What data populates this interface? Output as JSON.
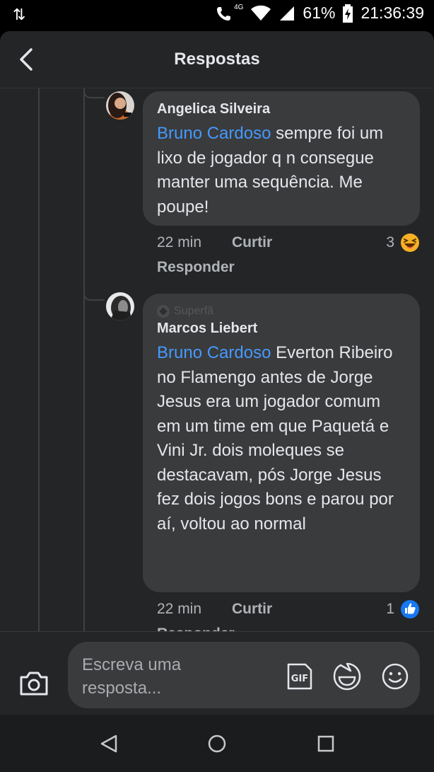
{
  "status": {
    "network": "4G",
    "battery": "61%",
    "time": "21:36:39"
  },
  "header": {
    "title": "Respostas",
    "back_icon": "back-arrow-icon"
  },
  "comments": [
    {
      "author": "Angelica Silveira",
      "mention": "Bruno Cardoso",
      "text": " sempre foi um lixo de jogador q n consegue manter uma sequência. Me poupe!",
      "time": "22 min",
      "like_label": "Curtir",
      "reply_label": "Responder",
      "reaction_count": "3",
      "reaction_icon": "haha-emoji-icon"
    },
    {
      "badge": "Superfã",
      "author": "Marcos Liebert",
      "mention": "Bruno Cardoso",
      "text": " Everton Ribeiro no Flamengo antes de Jorge Jesus era um jogador comum em um time em que Paquetá e Vini Jr. dois moleques se destacavam, pós Jorge Jesus fez dois jogos bons e parou por aí, voltou ao normal",
      "time": "22 min",
      "like_label": "Curtir",
      "reply_label": "Responder",
      "reaction_count": "1",
      "reaction_icon": "like-thumb-icon"
    }
  ],
  "composer": {
    "placeholder": "Escreva uma resposta...",
    "gif_label": "GIF",
    "camera_icon": "camera-icon",
    "sticker_icon": "sticker-icon",
    "emoji_icon": "emoji-icon"
  },
  "colors": {
    "background": "#242526",
    "bubble": "#3a3b3c",
    "mention": "#4599ff",
    "like_blue": "#1877f2"
  }
}
